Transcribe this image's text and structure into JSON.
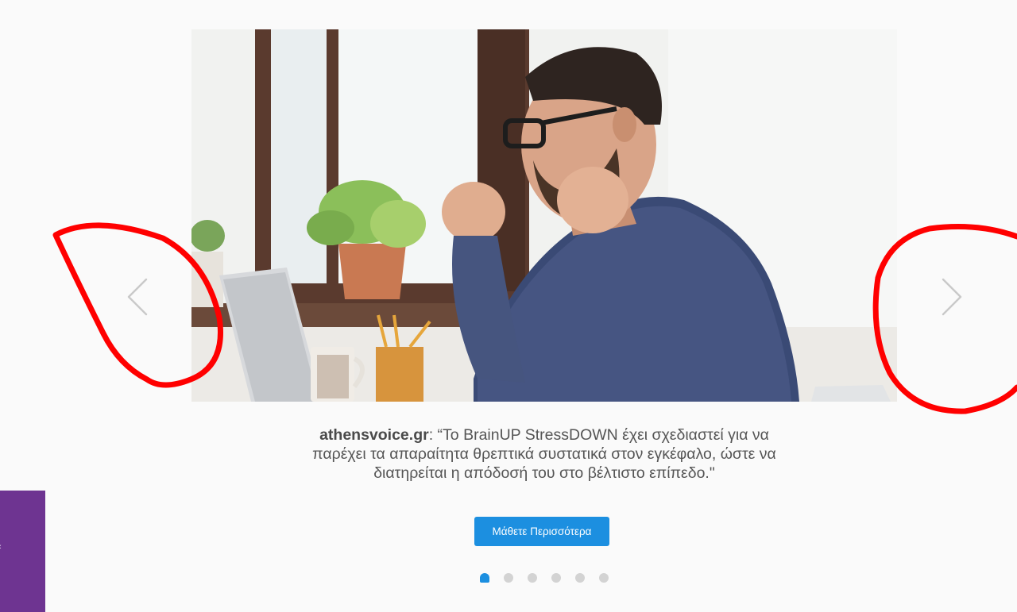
{
  "carousel": {
    "prev_icon": "chevron-left-icon",
    "next_icon": "chevron-right-icon",
    "image_alt": "man celebrating at laptop",
    "caption_source": "athensvoice.gr",
    "caption_text": ": “Το BrainUP StressDOWN έχει σχεδιαστεί για να παρέχει τα απαραίτητα θρεπτικά συστατικά στον εγκέφαλο, ώστε να διατηρείται η απόδοσή του στο βέλτιστο επίπεδο.\"",
    "cta_label": "Μάθετε Περισσότερα",
    "dots_count": 6,
    "active_dot": 1
  },
  "side_tab": {
    "glyph": "‹"
  },
  "colors": {
    "accent": "#1c8fe0",
    "annotation": "#ff0000",
    "side_tab": "#6e3491",
    "dot_inactive": "#d3d3d3"
  }
}
